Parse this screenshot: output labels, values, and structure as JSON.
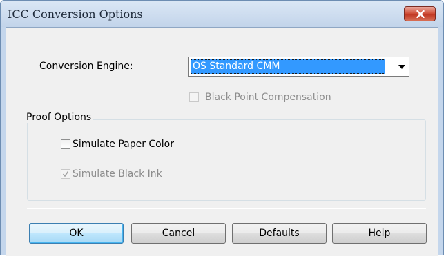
{
  "window": {
    "title": "ICC Conversion Options"
  },
  "engine": {
    "label": "Conversion Engine:",
    "selected": "OS Standard CMM"
  },
  "black_point": {
    "label": "Black Point Compensation",
    "checked": false,
    "enabled": false
  },
  "proof": {
    "title": "Proof Options",
    "paper_color": {
      "label": "Simulate Paper Color",
      "checked": false
    },
    "black_ink": {
      "label": "Simulate Black Ink",
      "checked": true,
      "enabled": false
    }
  },
  "buttons": {
    "ok": "OK",
    "cancel": "Cancel",
    "defaults": "Defaults",
    "help": "Help"
  }
}
